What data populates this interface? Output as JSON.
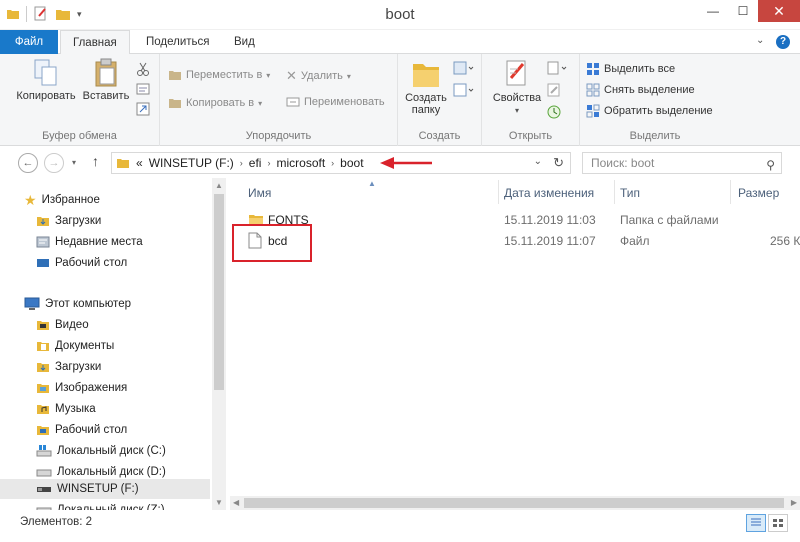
{
  "window": {
    "title": "boot",
    "minimize": "—",
    "maximize": "☐",
    "close": "✕"
  },
  "tabs": {
    "file": "Файл",
    "home": "Главная",
    "share": "Поделиться",
    "view": "Вид"
  },
  "ribbon": {
    "clipboard": {
      "copy": "Копировать",
      "paste": "Вставить",
      "label": "Буфер обмена"
    },
    "organize": {
      "move_to": "Переместить в",
      "copy_to": "Копировать в",
      "delete": "Удалить",
      "rename": "Переименовать",
      "label": "Упорядочить"
    },
    "new": {
      "new_folder_l1": "Создать",
      "new_folder_l2": "папку",
      "label": "Создать"
    },
    "open": {
      "properties": "Свойства",
      "label": "Открыть"
    },
    "select": {
      "select_all": "Выделить все",
      "select_none": "Снять выделение",
      "invert": "Обратить выделение",
      "label": "Выделить"
    }
  },
  "address": {
    "prefix": "«",
    "crumbs": [
      "WINSETUP (F:)",
      "efi",
      "microsoft",
      "boot"
    ],
    "search_placeholder": "Поиск: boot"
  },
  "nav": {
    "favorites": "Избранное",
    "fav_items": [
      "Загрузки",
      "Недавние места",
      "Рабочий стол"
    ],
    "computer": "Этот компьютер",
    "pc_items": [
      "Видео",
      "Документы",
      "Загрузки",
      "Изображения",
      "Музыка",
      "Рабочий стол",
      "Локальный диск (C:)",
      "Локальный диск (D:)",
      "WINSETUP (F:)",
      "Локальный диск (Z:)"
    ]
  },
  "columns": {
    "name": "Имя",
    "date": "Дата изменения",
    "type": "Тип",
    "size": "Размер"
  },
  "files": [
    {
      "name": "FONTS",
      "date": "15.11.2019 11:03",
      "type": "Папка с файлами",
      "size": ""
    },
    {
      "name": "bcd",
      "date": "15.11.2019 11:07",
      "type": "Файл",
      "size": "256 К"
    }
  ],
  "status": {
    "items": "Элементов: 2"
  },
  "colors": {
    "accent": "#1979ca",
    "annotation": "#d9222b",
    "folder": "#e8b83a"
  }
}
